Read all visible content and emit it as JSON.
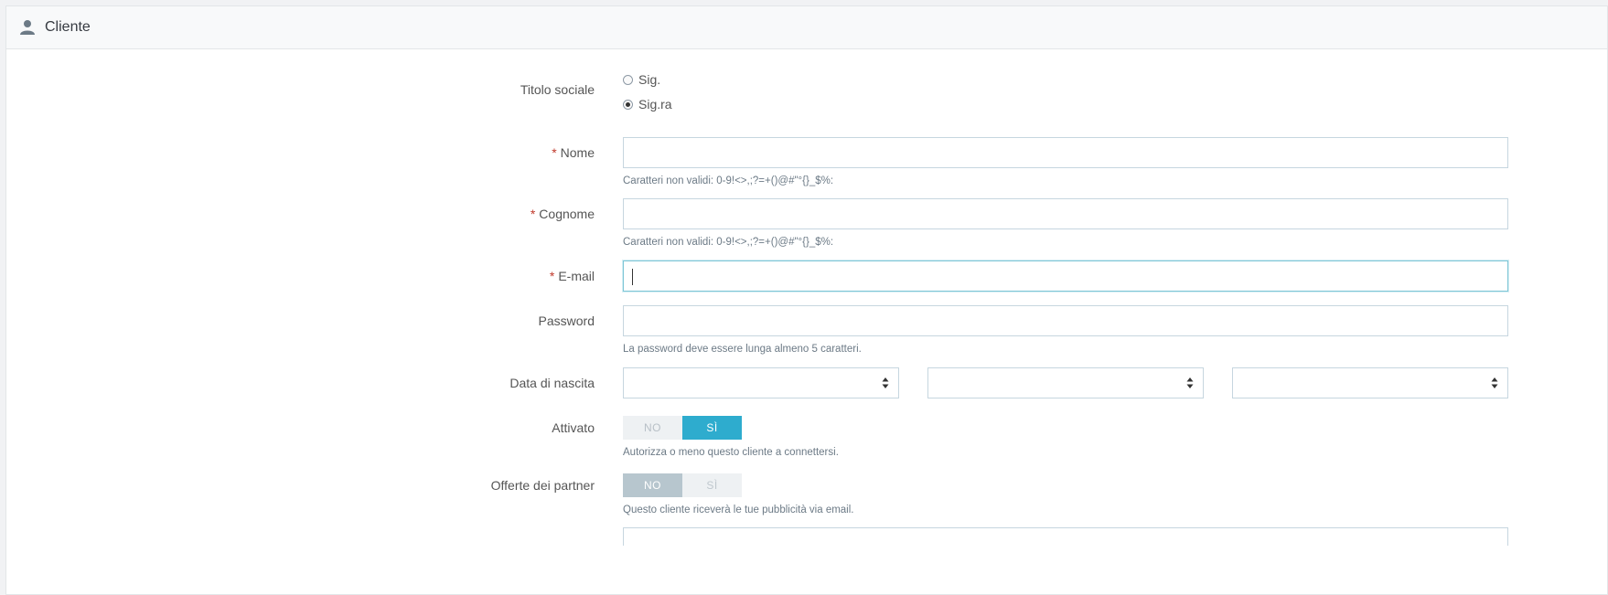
{
  "header": {
    "title": "Cliente",
    "icon": "user-icon"
  },
  "form": {
    "social_title": {
      "label": "Titolo sociale",
      "options": [
        "Sig.",
        "Sig.ra"
      ],
      "selected": "Sig.ra"
    },
    "first_name": {
      "label": "Nome",
      "required_mark": "*",
      "value": "",
      "help": "Caratteri non validi: 0-9!<>,;?=+()@#\"°{}_$%:"
    },
    "last_name": {
      "label": "Cognome",
      "required_mark": "*",
      "value": "",
      "help": "Caratteri non validi: 0-9!<>,;?=+()@#\"°{}_$%:"
    },
    "email": {
      "label": "E-mail",
      "required_mark": "*",
      "value": ""
    },
    "password": {
      "label": "Password",
      "value": "",
      "help": "La password deve essere lunga almeno 5 caratteri."
    },
    "birthday": {
      "label": "Data di nascita",
      "day": "",
      "month": "",
      "year": ""
    },
    "enabled": {
      "label": "Attivato",
      "no": "NO",
      "yes": "SÌ",
      "value": "yes",
      "help": "Autorizza o meno questo cliente a connettersi."
    },
    "partner_offers": {
      "label": "Offerte dei partner",
      "no": "NO",
      "yes": "SÌ",
      "value": "no",
      "help": "Questo cliente riceverà le tue pubblicità via email."
    }
  },
  "colors": {
    "accent": "#2eacce",
    "required": "#c0392b",
    "input_border": "#c6d6df"
  }
}
